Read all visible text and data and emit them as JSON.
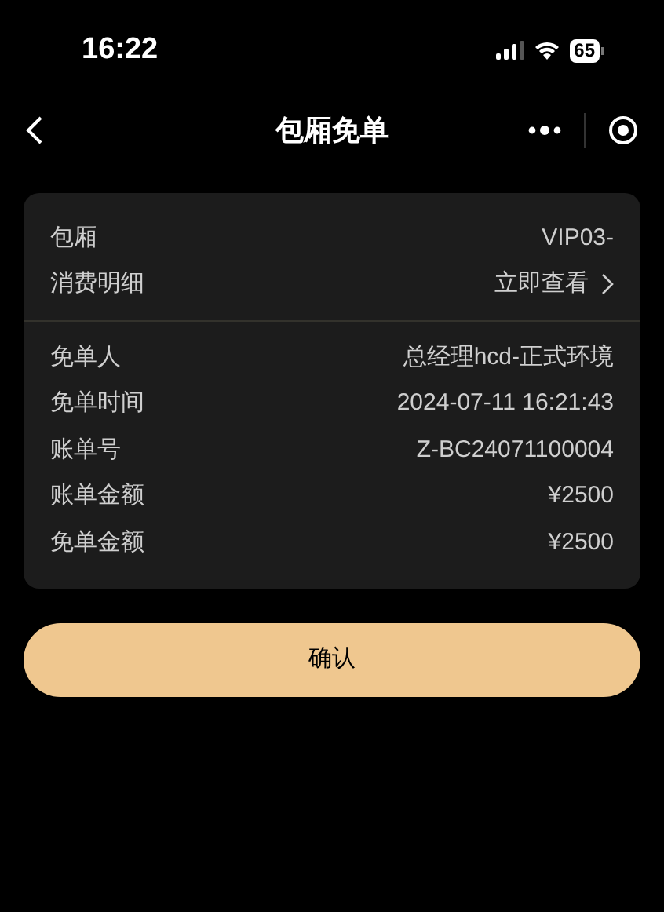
{
  "status_bar": {
    "time": "16:22",
    "battery": "65"
  },
  "nav": {
    "title": "包厢免单"
  },
  "sections": [
    {
      "rows": [
        {
          "kind": "plain",
          "label": "包厢",
          "value": "VIP03-"
        },
        {
          "kind": "link",
          "label": "消费明细",
          "value": "立即查看"
        }
      ]
    },
    {
      "rows": [
        {
          "kind": "plain",
          "label": "免单人",
          "value": "总经理hcd-正式环境"
        },
        {
          "kind": "plain",
          "label": "免单时间",
          "value": "2024-07-11 16:21:43"
        },
        {
          "kind": "plain",
          "label": "账单号",
          "value": "Z-BC24071100004"
        },
        {
          "kind": "plain",
          "label": "账单金额",
          "value": "¥2500"
        },
        {
          "kind": "plain",
          "label": "免单金额",
          "value": "¥2500"
        }
      ]
    }
  ],
  "confirm_button": "确认"
}
